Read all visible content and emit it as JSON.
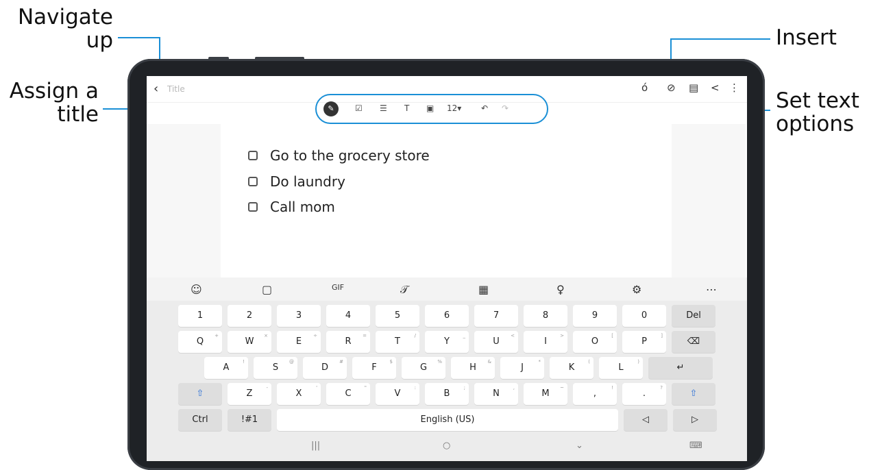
{
  "callouts": {
    "navigate_up": "Navigate\nup",
    "assign_title": "Assign a\ntitle",
    "insert": "Insert",
    "set_text_options": "Set text\noptions"
  },
  "topbar": {
    "back_icon": "‹",
    "title_placeholder": "Title",
    "icons": [
      "handwriting-icon",
      "attach-icon",
      "pdf-icon",
      "share-icon",
      "more-icon"
    ]
  },
  "toolbar": {
    "font_size": "12"
  },
  "note": {
    "items": [
      "Go to the grocery store",
      "Do laundry",
      "Call mom"
    ]
  },
  "keyboard": {
    "rows": [
      [
        {
          "k": "1"
        },
        {
          "k": "2"
        },
        {
          "k": "3"
        },
        {
          "k": "4"
        },
        {
          "k": "5"
        },
        {
          "k": "6"
        },
        {
          "k": "7"
        },
        {
          "k": "8"
        },
        {
          "k": "9"
        },
        {
          "k": "0"
        },
        {
          "k": "Del"
        }
      ],
      [
        {
          "k": "Q",
          "s": "+"
        },
        {
          "k": "W",
          "s": "×"
        },
        {
          "k": "E",
          "s": "÷"
        },
        {
          "k": "R",
          "s": "="
        },
        {
          "k": "T",
          "s": "/"
        },
        {
          "k": "Y",
          "s": "_"
        },
        {
          "k": "U",
          "s": "<"
        },
        {
          "k": "I",
          "s": ">"
        },
        {
          "k": "O",
          "s": "["
        },
        {
          "k": "P",
          "s": "]"
        },
        {
          "k": "⌫"
        }
      ],
      [
        {
          "k": "A",
          "s": "!"
        },
        {
          "k": "S",
          "s": "@"
        },
        {
          "k": "D",
          "s": "#"
        },
        {
          "k": "F",
          "s": "$"
        },
        {
          "k": "G",
          "s": "%"
        },
        {
          "k": "H",
          "s": "&"
        },
        {
          "k": "J",
          "s": "*"
        },
        {
          "k": "K",
          "s": "("
        },
        {
          "k": "L",
          "s": ")"
        },
        {
          "k": "↵"
        }
      ],
      [
        {
          "k": "⇧"
        },
        {
          "k": "Z",
          "s": "-"
        },
        {
          "k": "X",
          "s": "'"
        },
        {
          "k": "C",
          "s": "\""
        },
        {
          "k": "V",
          "s": ":"
        },
        {
          "k": "B",
          "s": ";"
        },
        {
          "k": "N",
          "s": ","
        },
        {
          "k": "M",
          "s": "~"
        },
        {
          "k": ",",
          "s": "!"
        },
        {
          "k": ".",
          "s": "?"
        },
        {
          "k": "⇧"
        }
      ],
      [
        {
          "k": "Ctrl"
        },
        {
          "k": "!#1"
        },
        {
          "k": "English (US)"
        },
        {
          "k": "◁"
        },
        {
          "k": "▷"
        }
      ]
    ],
    "toolbar_icons": [
      "emoji-icon",
      "sticker-icon",
      "gif-icon",
      "handwriting-icon",
      "keyboard-mode-icon",
      "microphone-icon",
      "settings-icon",
      "more-icon"
    ]
  },
  "navbar": {
    "recent": "|||",
    "home": "○",
    "back": "⌄",
    "keyboard": "⌨"
  }
}
